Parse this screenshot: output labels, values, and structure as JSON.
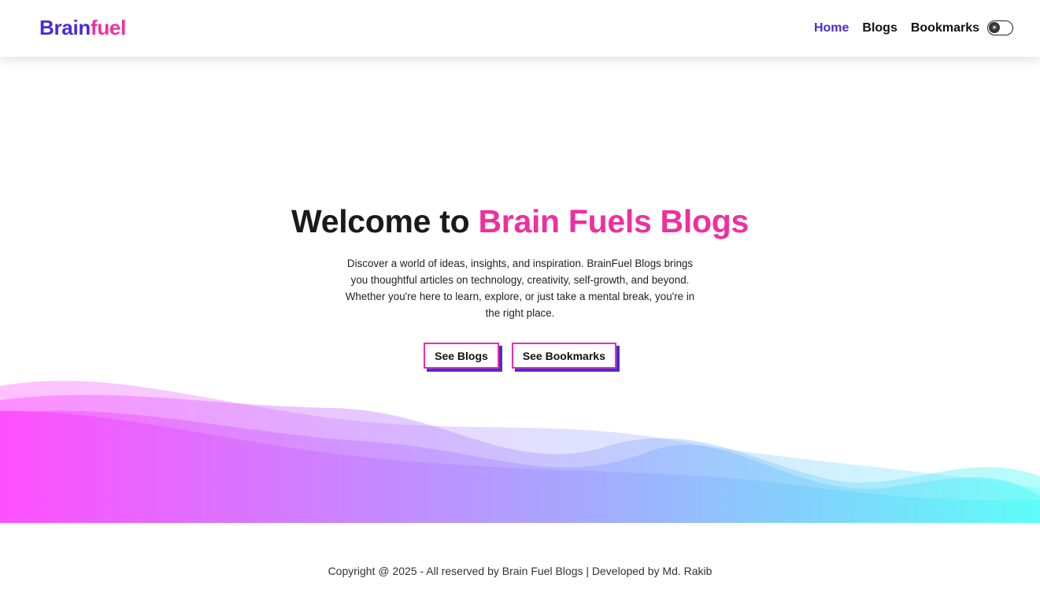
{
  "brand": {
    "part1": "Brain",
    "part2": "fuel"
  },
  "nav": {
    "items": [
      {
        "label": "Home",
        "active": true
      },
      {
        "label": "Blogs",
        "active": false
      },
      {
        "label": "Bookmarks",
        "active": false
      }
    ],
    "theme_toggle_icon": "sun-icon"
  },
  "hero": {
    "title_prefix": "Welcome to",
    "title_highlight": "Brain Fuels Blogs",
    "description": "Discover a world of ideas, insights, and inspiration. BrainFuel Blogs brings you thoughtful articles on technology, creativity, self-growth, and beyond. Whether you're here to learn, explore, or just take a mental break, you're in the right place.",
    "buttons": {
      "blogs": "See Blogs",
      "bookmarks": "See Bookmarks"
    }
  },
  "footer": {
    "text": "Copyright @ 2025 - All reserved by Brain Fuel Blogs | Developed by Md. Rakib"
  },
  "colors": {
    "brand_primary": "#4a2bd6",
    "brand_accent": "#ef2f9f",
    "wave_left": "#ff4dff",
    "wave_right": "#5cfdf8"
  }
}
